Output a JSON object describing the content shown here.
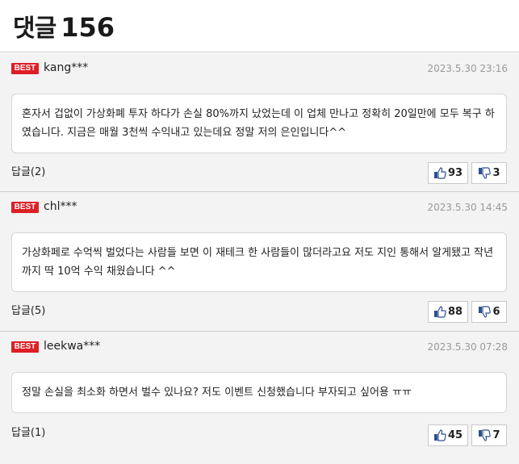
{
  "header": {
    "title": "댓글",
    "count": "156"
  },
  "comments": [
    {
      "badge": "BEST",
      "user": "kang***",
      "date": "2023.5.30 23:16",
      "text": "혼자서 겁없이 가상화폐 투자 하다가 손실 80%까지 났었는데 이 업체 만나고 정확히 20일만에 모두 복구 하였습니다. 지금은 매월 3천씩 수익내고 있는데요 정말 저의 은인입니다^^",
      "reply": "답글(2)",
      "likes": "93",
      "dislikes": "3"
    },
    {
      "badge": "BEST",
      "user": "chl***",
      "date": "2023.5.30 14:45",
      "text": "가상화페로 수억씩 벌었다는 사람들 보면 이 재테크 한 사람들이 많더라고요 저도 지인 통해서 알게됐고 작년까지 딱 10억 수익 채웠습니다 ^^",
      "reply": "답글(5)",
      "likes": "88",
      "dislikes": "6"
    },
    {
      "badge": "BEST",
      "user": "leekwa***",
      "date": "2023.5.30 07:28",
      "text": "정말 손실을 최소화 하면서 벌수 있나요? 저도 이벤트 신청했습니다 부자되고 싶어용 ㅠㅠ",
      "reply": "답글(1)",
      "likes": "45",
      "dislikes": "7"
    }
  ]
}
